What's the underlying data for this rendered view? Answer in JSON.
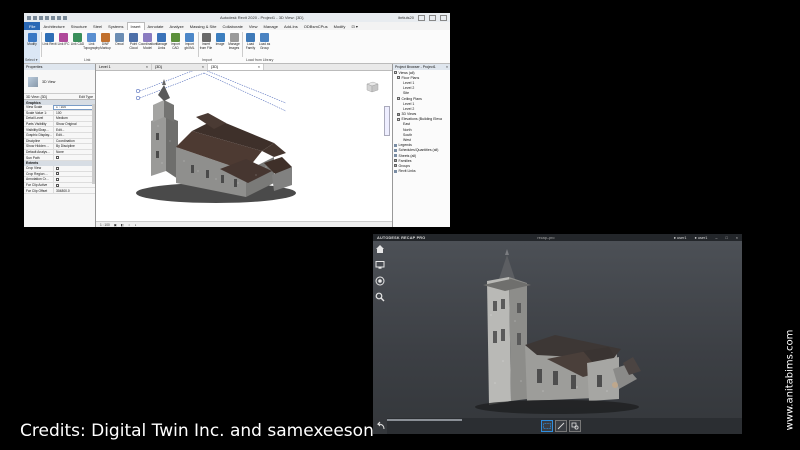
{
  "revit": {
    "window_title": "Autodesk Revit 2020 - Project1 - 3D View: {3D}",
    "user": "ibrtiuls20",
    "tabs": [
      "File",
      "Architecture",
      "Structure",
      "Steel",
      "Systems",
      "Insert",
      "Annotate",
      "Analyze",
      "Massing & Site",
      "Collaborate",
      "View",
      "Manage",
      "Add-Ins",
      "ODBsmCPus",
      "Modify",
      "⊡ ▾"
    ],
    "active_tab": "Insert",
    "ribbon_tools": [
      "Modify",
      "Link Revit",
      "Link IFC",
      "Link CAD",
      "Link Topography",
      "DWF Markup",
      "Decal",
      "Point Cloud",
      "Coordination Model",
      "Manage Links",
      "Import CAD",
      "Import gbXML",
      "Insert from File",
      "Image",
      "Manage Images",
      "Load Family",
      "Load as Group"
    ],
    "ribbon_panels": [
      "Select ▾",
      "Link",
      "Import",
      "Load from Library"
    ],
    "properties": {
      "header": "Properties",
      "type_name": "3D View",
      "view_selector": "3D View: {3D}",
      "edit_type": "Edit Type",
      "groups": [
        {
          "name": "Graphics",
          "rows": [
            {
              "k": "View Scale",
              "v": "1 : 100",
              "input": true
            },
            {
              "k": "Scale Value 1:",
              "v": "100"
            },
            {
              "k": "Detail Level",
              "v": "Medium"
            },
            {
              "k": "Parts Visibility",
              "v": "Show Original"
            },
            {
              "k": "Visibility/Grap...",
              "v": "Edit..."
            },
            {
              "k": "Graphic Display...",
              "v": "Edit..."
            },
            {
              "k": "Discipline",
              "v": "Coordination"
            },
            {
              "k": "Show Hidden ...",
              "v": "By Discipline"
            },
            {
              "k": "Default Analys...",
              "v": "None"
            },
            {
              "k": "Sun Path",
              "v": "",
              "check": true
            }
          ]
        },
        {
          "name": "Extents",
          "rows": [
            {
              "k": "Crop View",
              "v": "",
              "check": true
            },
            {
              "k": "Crop Region ...",
              "v": "",
              "check": true
            },
            {
              "k": "Annotation Cr...",
              "v": "",
              "check": true
            },
            {
              "k": "Far Clip Active",
              "v": "",
              "check": true
            },
            {
              "k": "Far Clip Offset",
              "v": "304800.0"
            }
          ]
        }
      ],
      "footer_help": "Properties help",
      "apply": "Apply"
    },
    "view_tabs": [
      {
        "label": "Level 1"
      },
      {
        "label": "{3D}"
      },
      {
        "label": "{3D}",
        "active": true
      }
    ],
    "status_scale": "1 : 100",
    "browser": {
      "header": "Project Browser - Project1",
      "nodes": [
        {
          "label": "Views (all)",
          "indent": 0,
          "tog": "−"
        },
        {
          "label": "Floor Plans",
          "indent": 1,
          "tog": "−"
        },
        {
          "label": "Level 1",
          "indent": 3
        },
        {
          "label": "Level 2",
          "indent": 3
        },
        {
          "label": "Site",
          "indent": 3
        },
        {
          "label": "Ceiling Plans",
          "indent": 1,
          "tog": "−"
        },
        {
          "label": "Level 1",
          "indent": 3
        },
        {
          "label": "Level 2",
          "indent": 3
        },
        {
          "label": "3D Views",
          "indent": 1,
          "tog": "+"
        },
        {
          "label": "Elevations (Building Eleva",
          "indent": 1,
          "tog": "−"
        },
        {
          "label": "East",
          "indent": 3
        },
        {
          "label": "North",
          "indent": 3
        },
        {
          "label": "South",
          "indent": 3
        },
        {
          "label": "West",
          "indent": 3
        },
        {
          "label": "Legends",
          "indent": 0,
          "icon": true
        },
        {
          "label": "Schedules/Quantities (all)",
          "indent": 0,
          "icon": true
        },
        {
          "label": "Sheets (all)",
          "indent": 0,
          "icon": true
        },
        {
          "label": "Families",
          "indent": 0,
          "tog": "+"
        },
        {
          "label": "Groups",
          "indent": 0,
          "tog": "+"
        },
        {
          "label": "Revit Links",
          "indent": 0,
          "icon": true
        }
      ]
    }
  },
  "recap": {
    "brand": "AUTODESK  RECAP PRO",
    "project_title": "recap–pro",
    "user_left": "● user1",
    "user_right": "● user1",
    "side_icons": [
      "home-icon",
      "display-icon",
      "target-icon",
      "search-icon"
    ],
    "bottom_tools": [
      "select-window-icon",
      "measure-icon",
      "annotate-icon"
    ],
    "colors": {
      "accent": "#2f8fe0"
    }
  },
  "credits": "Credits: Digital Twin Inc. and samexeeson",
  "watermark": "www.anitabims.com"
}
